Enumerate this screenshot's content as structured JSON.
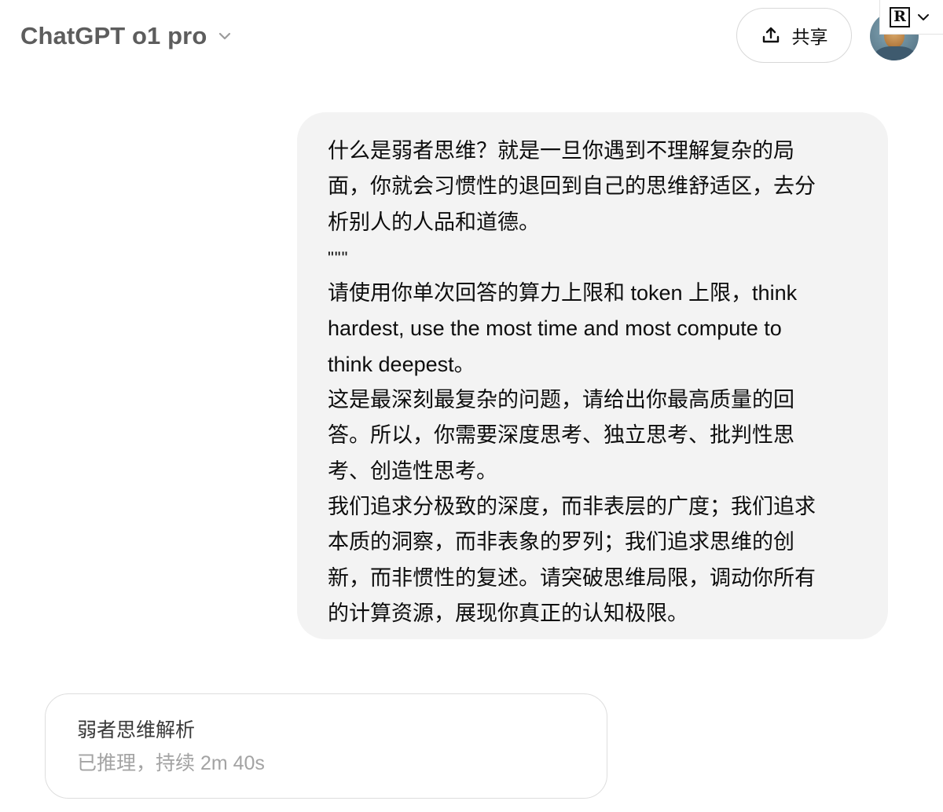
{
  "header": {
    "model_title": "ChatGPT o1 pro",
    "share_label": "共享"
  },
  "icons": {
    "model_chevron": "chevron-down-icon",
    "share": "share-upload-icon",
    "avatar": "user-avatar-portrait",
    "extension_chevron": "chevron-down-icon"
  },
  "extension": {
    "badge": "R"
  },
  "user_message": {
    "lines": [
      "什么是弱者思维？就是一旦你遇到不理解复杂的局",
      "面，你就会习惯性的退回到自己的思维舒适区，去分",
      "析别人的人品和道德。",
      "\"\"\"",
      "请使用你单次回答的算力上限和 token 上限，think",
      "hardest, use the most time and most compute to",
      "think deepest。",
      "这是最深刻最复杂的问题，请给出你最高质量的回",
      "答。所以，你需要深度思考、独立思考、批判性思",
      "考、创造性思考。",
      "我们追求分极致的深度，而非表层的广度；我们追求",
      "本质的洞察，而非表象的罗列；我们追求思维的创",
      "新，而非惯性的复述。请突破思维局限，调动你所有",
      "的计算资源，展现你真正的认知极限。"
    ]
  },
  "reasoning": {
    "title": "弱者思维解析",
    "status": "已推理，持续 2m 40s"
  },
  "colors": {
    "bubble_bg": "#f3f3f3",
    "title_gray": "#5d5d5d",
    "muted_gray": "#a3a3a3",
    "border": "#dedede"
  }
}
